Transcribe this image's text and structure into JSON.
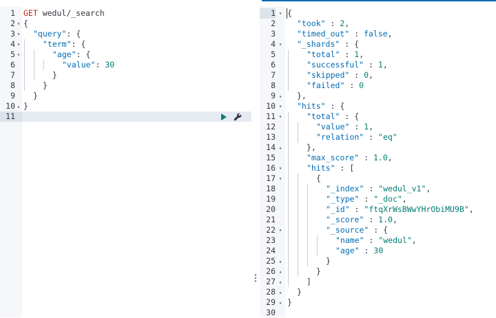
{
  "request": {
    "lines": [
      [
        {
          "t": "method",
          "v": "GET"
        },
        {
          "t": "url",
          "v": " wedul/_search"
        }
      ],
      [
        {
          "t": "punc",
          "v": "{"
        }
      ],
      [
        {
          "t": "key",
          "v": "\"query\""
        },
        {
          "t": "punc",
          "v": ": {"
        }
      ],
      [
        {
          "t": "key",
          "v": "\"term\""
        },
        {
          "t": "punc",
          "v": ": {"
        }
      ],
      [
        {
          "t": "key",
          "v": "\"age\""
        },
        {
          "t": "punc",
          "v": ": {"
        }
      ],
      [
        {
          "t": "key",
          "v": "\"value\""
        },
        {
          "t": "punc",
          "v": ": "
        },
        {
          "t": "num",
          "v": "30"
        }
      ],
      [
        {
          "t": "punc",
          "v": "}"
        }
      ],
      [
        {
          "t": "punc",
          "v": "}"
        }
      ],
      [
        {
          "t": "punc",
          "v": "}"
        }
      ],
      [
        {
          "t": "punc",
          "v": "}"
        }
      ],
      []
    ],
    "line_numbers": [
      "1",
      "2",
      "3",
      "4",
      "5",
      "6",
      "7",
      "8",
      "9",
      "10",
      "11"
    ],
    "folds": [
      "",
      "▾",
      "▾",
      "▾",
      "▾",
      "",
      "",
      "",
      "",
      "▴",
      ""
    ],
    "indents": [
      0,
      0,
      1,
      2,
      3,
      4,
      3,
      2,
      1,
      0,
      0
    ],
    "guides": [
      0,
      0,
      0,
      1,
      2,
      3,
      2,
      1,
      0,
      0,
      0
    ],
    "active_line": 10,
    "run_icon": "play-icon",
    "settings_icon": "wrench-icon"
  },
  "response": {
    "lines": [
      [
        {
          "t": "punc",
          "v": "{"
        }
      ],
      [
        {
          "t": "key",
          "v": "\"took\""
        },
        {
          "t": "punc",
          "v": " : "
        },
        {
          "t": "num",
          "v": "2"
        },
        {
          "t": "punc",
          "v": ","
        }
      ],
      [
        {
          "t": "key",
          "v": "\"timed_out\""
        },
        {
          "t": "punc",
          "v": " : "
        },
        {
          "t": "bool",
          "v": "false"
        },
        {
          "t": "punc",
          "v": ","
        }
      ],
      [
        {
          "t": "key",
          "v": "\"_shards\""
        },
        {
          "t": "punc",
          "v": " : {"
        }
      ],
      [
        {
          "t": "key",
          "v": "\"total\""
        },
        {
          "t": "punc",
          "v": " : "
        },
        {
          "t": "num",
          "v": "1"
        },
        {
          "t": "punc",
          "v": ","
        }
      ],
      [
        {
          "t": "key",
          "v": "\"successful\""
        },
        {
          "t": "punc",
          "v": " : "
        },
        {
          "t": "num",
          "v": "1"
        },
        {
          "t": "punc",
          "v": ","
        }
      ],
      [
        {
          "t": "key",
          "v": "\"skipped\""
        },
        {
          "t": "punc",
          "v": " : "
        },
        {
          "t": "num",
          "v": "0"
        },
        {
          "t": "punc",
          "v": ","
        }
      ],
      [
        {
          "t": "key",
          "v": "\"failed\""
        },
        {
          "t": "punc",
          "v": " : "
        },
        {
          "t": "num",
          "v": "0"
        }
      ],
      [
        {
          "t": "punc",
          "v": "},"
        }
      ],
      [
        {
          "t": "key",
          "v": "\"hits\""
        },
        {
          "t": "punc",
          "v": " : {"
        }
      ],
      [
        {
          "t": "key",
          "v": "\"total\""
        },
        {
          "t": "punc",
          "v": " : {"
        }
      ],
      [
        {
          "t": "key",
          "v": "\"value\""
        },
        {
          "t": "punc",
          "v": " : "
        },
        {
          "t": "num",
          "v": "1"
        },
        {
          "t": "punc",
          "v": ","
        }
      ],
      [
        {
          "t": "key",
          "v": "\"relation\""
        },
        {
          "t": "punc",
          "v": " : "
        },
        {
          "t": "str",
          "v": "\"eq\""
        }
      ],
      [
        {
          "t": "punc",
          "v": "},"
        }
      ],
      [
        {
          "t": "key",
          "v": "\"max_score\""
        },
        {
          "t": "punc",
          "v": " : "
        },
        {
          "t": "num",
          "v": "1.0"
        },
        {
          "t": "punc",
          "v": ","
        }
      ],
      [
        {
          "t": "key",
          "v": "\"hits\""
        },
        {
          "t": "punc",
          "v": " : ["
        }
      ],
      [
        {
          "t": "punc",
          "v": "{"
        }
      ],
      [
        {
          "t": "key",
          "v": "\"_index\""
        },
        {
          "t": "punc",
          "v": " : "
        },
        {
          "t": "str",
          "v": "\"wedul_v1\""
        },
        {
          "t": "punc",
          "v": ","
        }
      ],
      [
        {
          "t": "key",
          "v": "\"_type\""
        },
        {
          "t": "punc",
          "v": " : "
        },
        {
          "t": "str",
          "v": "\"_doc\""
        },
        {
          "t": "punc",
          "v": ","
        }
      ],
      [
        {
          "t": "key",
          "v": "\"_id\""
        },
        {
          "t": "punc",
          "v": " : "
        },
        {
          "t": "str",
          "v": "\"ftqXrWsBWwYHrObiMU9B\""
        },
        {
          "t": "punc",
          "v": ","
        }
      ],
      [
        {
          "t": "key",
          "v": "\"_score\""
        },
        {
          "t": "punc",
          "v": " : "
        },
        {
          "t": "num",
          "v": "1.0"
        },
        {
          "t": "punc",
          "v": ","
        }
      ],
      [
        {
          "t": "key",
          "v": "\"_source\""
        },
        {
          "t": "punc",
          "v": " : {"
        }
      ],
      [
        {
          "t": "key",
          "v": "\"name\""
        },
        {
          "t": "punc",
          "v": " : "
        },
        {
          "t": "str",
          "v": "\"wedul\""
        },
        {
          "t": "punc",
          "v": ","
        }
      ],
      [
        {
          "t": "key",
          "v": "\"age\""
        },
        {
          "t": "punc",
          "v": " : "
        },
        {
          "t": "num",
          "v": "30"
        }
      ],
      [
        {
          "t": "punc",
          "v": "}"
        }
      ],
      [
        {
          "t": "punc",
          "v": "}"
        }
      ],
      [
        {
          "t": "punc",
          "v": "]"
        }
      ],
      [
        {
          "t": "punc",
          "v": "}"
        }
      ],
      [
        {
          "t": "punc",
          "v": "}"
        }
      ],
      []
    ],
    "line_numbers": [
      "1",
      "2",
      "3",
      "4",
      "5",
      "6",
      "7",
      "8",
      "9",
      "10",
      "11",
      "12",
      "13",
      "14",
      "15",
      "16",
      "17",
      "18",
      "19",
      "20",
      "21",
      "22",
      "23",
      "24",
      "25",
      "26",
      "27",
      "28",
      "29",
      "30"
    ],
    "folds": [
      "▾",
      "",
      "",
      "▾",
      "",
      "",
      "",
      "",
      "▴",
      "▾",
      "▾",
      "",
      "",
      "▴",
      "",
      "▾",
      "▾",
      "",
      "",
      "",
      "",
      "▾",
      "",
      "",
      "▴",
      "▴",
      "▴",
      "▴",
      "▴",
      ""
    ],
    "indents": [
      0,
      1,
      1,
      1,
      2,
      2,
      2,
      2,
      1,
      1,
      2,
      3,
      3,
      2,
      2,
      2,
      3,
      4,
      4,
      4,
      4,
      4,
      5,
      5,
      4,
      3,
      2,
      1,
      0,
      0
    ],
    "guides": [
      0,
      0,
      0,
      0,
      1,
      1,
      1,
      1,
      0,
      0,
      1,
      2,
      2,
      1,
      1,
      1,
      2,
      3,
      3,
      3,
      3,
      3,
      4,
      4,
      3,
      2,
      1,
      0,
      0,
      0
    ],
    "active_line": 0
  },
  "resizer_icon": "vertical-dots-icon"
}
